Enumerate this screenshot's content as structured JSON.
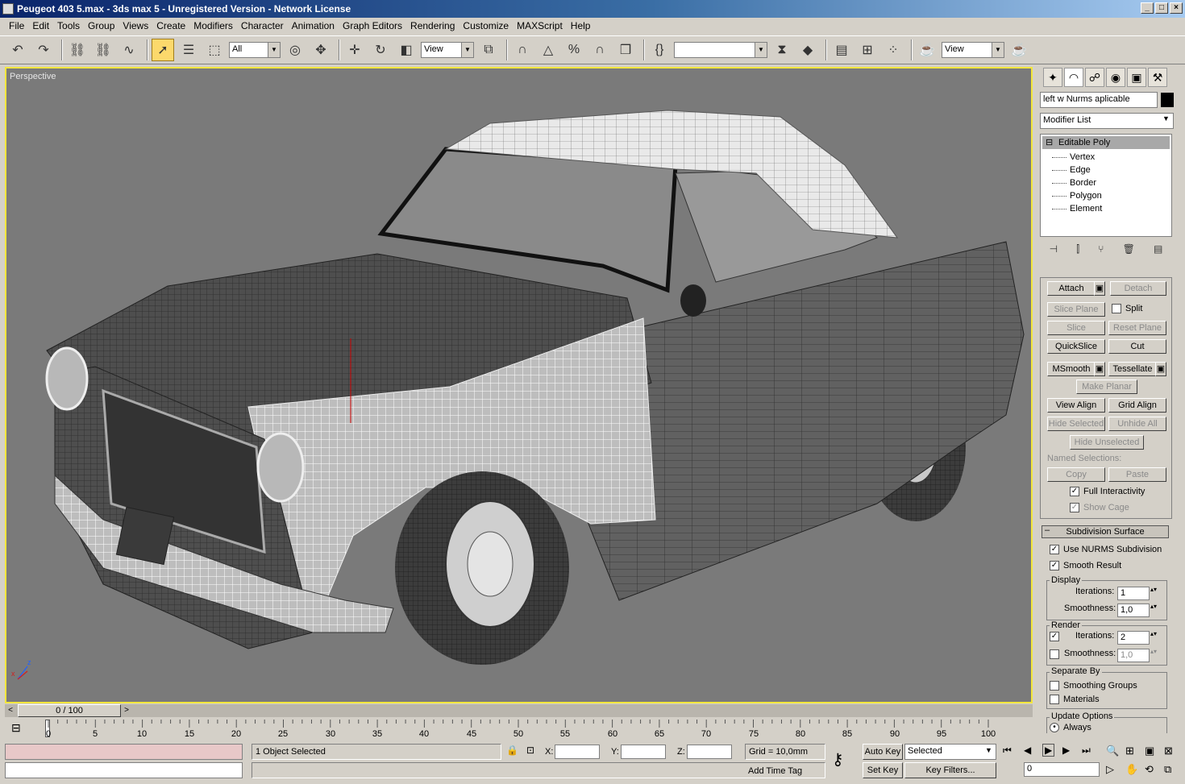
{
  "window": {
    "title": "Peugeot 403 5.max - 3ds max 5 - Unregistered Version - Network License",
    "controls": [
      "_",
      "□",
      "×"
    ]
  },
  "menu": [
    "File",
    "Edit",
    "Tools",
    "Group",
    "Views",
    "Create",
    "Modifiers",
    "Character",
    "Animation",
    "Graph Editors",
    "Rendering",
    "Customize",
    "MAXScript",
    "Help"
  ],
  "toolbar": {
    "selection_filter": "All",
    "ref_coord": "View",
    "named_sel": "",
    "render_view": "View"
  },
  "viewport": {
    "label": "Perspective",
    "axis_z": "z",
    "axis_x": "x"
  },
  "command_panel": {
    "object_name": "left w Nurms aplicable",
    "object_color": "#000000",
    "modifier_list": "Modifier List",
    "stack": {
      "base": "Editable Poly",
      "subobjects": [
        "Vertex",
        "Edge",
        "Border",
        "Polygon",
        "Element"
      ]
    },
    "edit_geometry": {
      "attach": "Attach",
      "detach": "Detach",
      "slice_plane": "Slice Plane",
      "split": "Split",
      "slice": "Slice",
      "reset_plane": "Reset Plane",
      "quickslice": "QuickSlice",
      "cut": "Cut",
      "msmooth": "MSmooth",
      "tessellate": "Tessellate",
      "make_planar": "Make Planar",
      "view_align": "View Align",
      "grid_align": "Grid Align",
      "hide_selected": "Hide Selected",
      "unhide_all": "Unhide All",
      "hide_unselected": "Hide Unselected",
      "named_selections": "Named Selections:",
      "copy": "Copy",
      "paste": "Paste",
      "full_interactivity": "Full Interactivity",
      "show_cage": "Show Cage"
    },
    "subdivision": {
      "header": "Subdivision Surface",
      "use_nurms": "Use NURMS Subdivision",
      "smooth_result": "Smooth Result",
      "display": "Display",
      "iterations_label": "Iterations:",
      "smoothness_label": "Smoothness:",
      "display_iterations": "1",
      "display_smoothness": "1,0",
      "render": "Render",
      "render_iterations": "2",
      "render_smoothness": "1,0",
      "separate_by": "Separate By",
      "smoothing_groups": "Smoothing Groups",
      "materials": "Materials",
      "update_options": "Update Options",
      "always": "Always"
    }
  },
  "timeline": {
    "frame": "0 / 100",
    "ticks": [
      "0",
      "5",
      "10",
      "15",
      "20",
      "25",
      "30",
      "35",
      "40",
      "45",
      "50",
      "55",
      "60",
      "65",
      "70",
      "75",
      "80",
      "85",
      "90",
      "95",
      "100"
    ]
  },
  "status": {
    "selection": "1 Object Selected",
    "x_label": "X:",
    "y_label": "Y:",
    "z_label": "Z:",
    "grid": "Grid = 10,0mm",
    "add_time_tag": "Add Time Tag",
    "auto_key": "Auto Key",
    "set_key": "Set Key",
    "key_mode": "Selected",
    "key_filters": "Key Filters...",
    "current_frame": "0"
  }
}
